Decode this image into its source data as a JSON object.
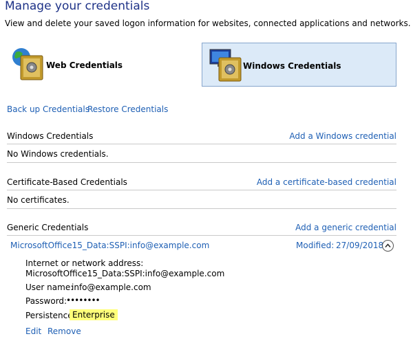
{
  "header": {
    "title": "Manage your credentials",
    "subtitle": "View and delete your saved logon information for websites, connected applications and networks."
  },
  "tiles": {
    "web": {
      "label": "Web Credentials"
    },
    "windows": {
      "label": "Windows Credentials",
      "selected": true
    }
  },
  "actions": {
    "backup": "Back up Credentials",
    "restore": "Restore Credentials"
  },
  "sections": {
    "windows": {
      "heading": "Windows Credentials",
      "add_link": "Add a Windows credential",
      "empty": "No Windows credentials."
    },
    "certificate": {
      "heading": "Certificate-Based Credentials",
      "add_link": "Add a certificate-based credential",
      "empty": "No certificates."
    },
    "generic": {
      "heading": "Generic Credentials",
      "add_link": "Add a generic credential"
    }
  },
  "credential": {
    "name": "MicrosoftOffice15_Data:SSPI:info@example.com",
    "modified_label": "Modified:",
    "modified_date": "27/09/2018",
    "address_label": "Internet or network address:",
    "address_value": "MicrosoftOffice15_Data:SSPI:info@example.com",
    "username_label": "User name:",
    "username_value": "info@example.com",
    "password_label": "Password:",
    "password_value": "••••••••",
    "persistence_label": "Persistence:",
    "persistence_value": "Enterprise",
    "edit": "Edit",
    "remove": "Remove"
  }
}
